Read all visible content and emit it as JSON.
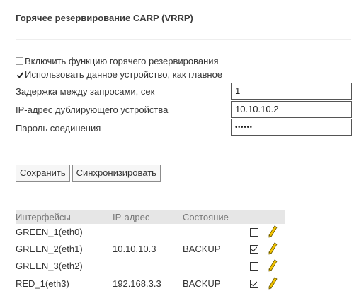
{
  "section": {
    "title": "Горячее резервирование CARP (VRRP)"
  },
  "options": {
    "enable_label": "Включить функцию горячего резервирования",
    "enable_checked": false,
    "master_label": "Использовать данное устройство, как главное",
    "master_checked": true
  },
  "fields": {
    "delay_label": "Задержка между запросами, сек",
    "delay_value": "1",
    "peer_ip_label": "IP-адрес дублирующего устройства",
    "peer_ip_value": "10.10.10.2",
    "password_label": "Пароль соединения",
    "password_value": "••••••"
  },
  "buttons": {
    "save_label": "Сохранить",
    "sync_label": "Синхронизировать"
  },
  "table": {
    "headers": {
      "interfaces": "Интерфейсы",
      "ip": "IP-адрес",
      "state": "Состояние"
    },
    "rows": [
      {
        "iface": "GREEN_1(eth0)",
        "ip": "",
        "state": "",
        "checked": false,
        "edit_icon": "pencil-icon"
      },
      {
        "iface": "GREEN_2(eth1)",
        "ip": "10.10.10.3",
        "state": "BACKUP",
        "checked": true,
        "edit_icon": "pencil-icon"
      },
      {
        "iface": "GREEN_3(eth2)",
        "ip": "",
        "state": "",
        "checked": false,
        "edit_icon": "pencil-icon"
      },
      {
        "iface": "RED_1(eth3)",
        "ip": "192.168.3.3",
        "state": "BACKUP",
        "checked": true,
        "edit_icon": "pencil-icon"
      }
    ]
  },
  "colors": {
    "pencil": "#f2c200",
    "header_bg": "#e6e6e6"
  }
}
